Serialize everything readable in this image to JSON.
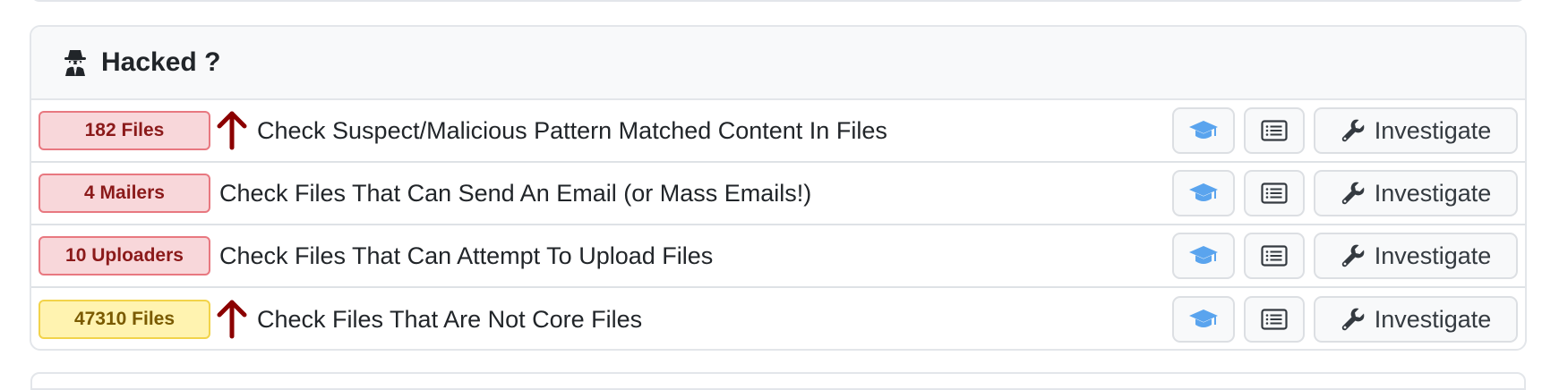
{
  "section": {
    "title": "Hacked ?",
    "icon": "user-secret-icon"
  },
  "colors": {
    "danger_bg": "#f8d7da",
    "danger_border": "#e87880",
    "danger_text": "#8b1a1a",
    "warning_bg": "#fff3b0",
    "warning_border": "#f2d34a",
    "warning_text": "#7a5a00",
    "arrow": "#8b0000",
    "learn_icon": "#5aa4ee"
  },
  "rows": [
    {
      "badge": "182 Files",
      "badge_level": "danger",
      "trend_up": true,
      "label": "Check Suspect/Malicious Pattern Matched Content In Files",
      "investigate_label": "Investigate"
    },
    {
      "badge": "4 Mailers",
      "badge_level": "danger",
      "trend_up": false,
      "label": "Check Files That Can Send An Email (or Mass Emails!)",
      "investigate_label": "Investigate"
    },
    {
      "badge": "10 Uploaders",
      "badge_level": "danger",
      "trend_up": false,
      "label": "Check Files That Can Attempt To Upload Files",
      "investigate_label": "Investigate"
    },
    {
      "badge": "47310 Files",
      "badge_level": "warning",
      "trend_up": true,
      "label": "Check Files That Are Not Core Files",
      "investigate_label": "Investigate"
    }
  ]
}
